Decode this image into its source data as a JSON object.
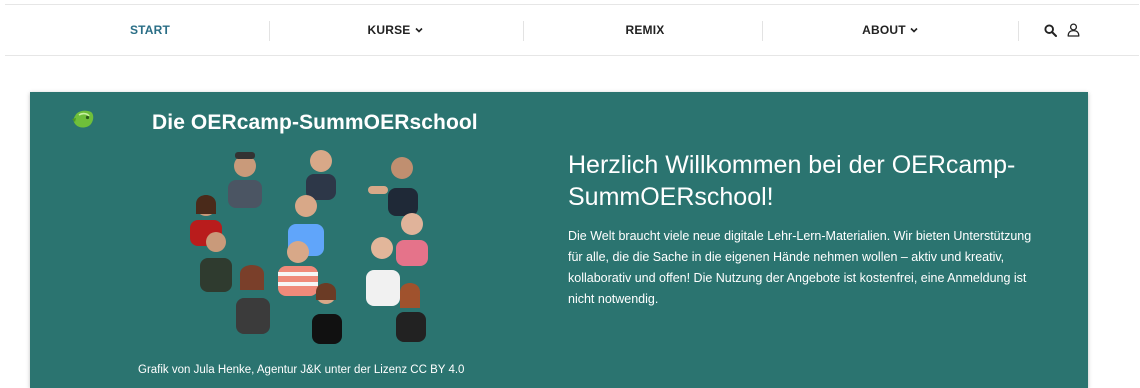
{
  "nav": {
    "items": [
      {
        "label": "START",
        "active": true
      },
      {
        "label": "KURSE",
        "has_dropdown": true
      },
      {
        "label": "REMIX"
      },
      {
        "label": "ABOUT",
        "has_dropdown": true
      }
    ],
    "icons": [
      "search-icon",
      "user-icon"
    ]
  },
  "hero": {
    "title": "Die OERcamp-SummOERschool",
    "caption": "Grafik von Jula Henke, Agentur J&K unter der Lizenz CC BY 4.0",
    "heading": "Herzlich Willkommen bei der OERcamp-SummOERschool!",
    "text": "Die Welt braucht viele neue digitale Lehr-Lern-Materialien. Wir bieten Unterstützung für alle, die die Sache in die eigenen Hände nehmen wollen – aktiv und kreativ, kollaborativ und offen! Die Nutzung der Angebote ist kostenfrei, eine Anmeldung ist nicht notwendig."
  },
  "colors": {
    "accent": "#2a6e86",
    "hero_background": "#2b7470",
    "logo_green": "#6fbf3a"
  }
}
